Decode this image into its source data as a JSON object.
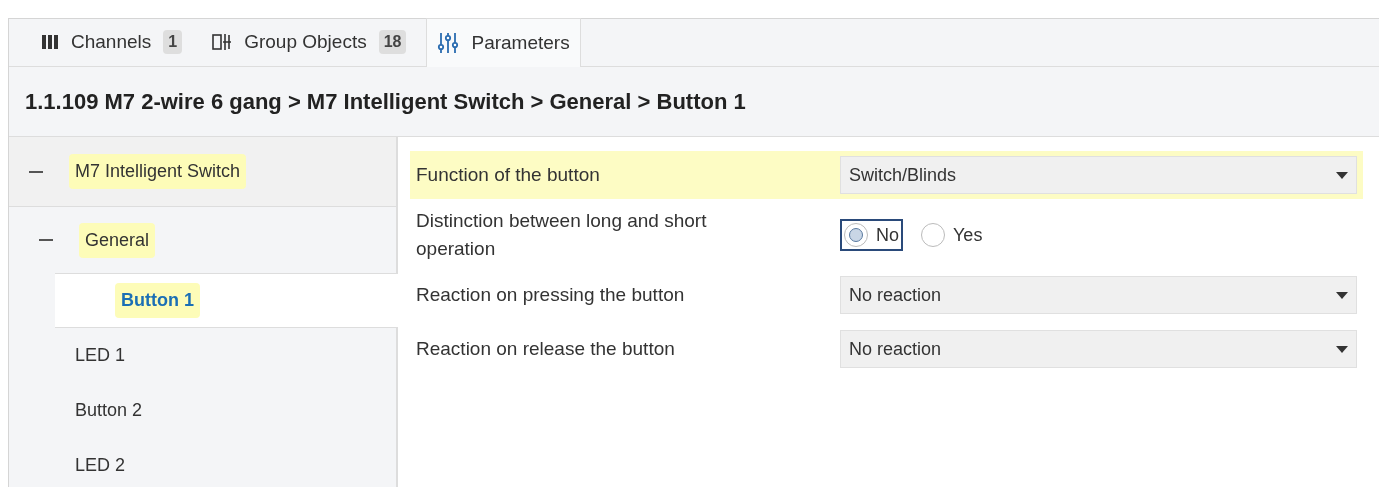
{
  "tabs": [
    {
      "kind": "channels",
      "label": "Channels",
      "count": "1",
      "selected": false
    },
    {
      "kind": "group-objects",
      "label": "Group Objects",
      "count": "18",
      "selected": false
    },
    {
      "kind": "parameters",
      "label": "Parameters",
      "selected": true
    }
  ],
  "breadcrumb": "1.1.109 M7 2-wire 6 gang > M7 Intelligent Switch > General > Button 1",
  "tree": [
    {
      "label": "M7 Intelligent Switch",
      "expanded": true,
      "highlighted": true,
      "selected": false,
      "children": [
        {
          "label": "General",
          "expanded": true,
          "highlighted": true,
          "selected": false,
          "children": [
            {
              "label": "Button 1",
              "highlighted": true,
              "selected": true
            },
            {
              "label": "LED 1",
              "highlighted": false,
              "selected": false
            },
            {
              "label": "Button 2",
              "highlighted": false,
              "selected": false
            },
            {
              "label": "LED 2",
              "highlighted": false,
              "selected": false
            }
          ]
        }
      ]
    }
  ],
  "parameters": [
    {
      "kind": "dropdown",
      "label": "Function of the button",
      "value": "Switch/Blinds",
      "highlighted": true
    },
    {
      "kind": "radio",
      "label": "Distinction between long and short operation",
      "highlighted": false,
      "options": [
        {
          "label": "No",
          "selected": true
        },
        {
          "label": "Yes",
          "selected": false
        }
      ]
    },
    {
      "kind": "dropdown",
      "label": "Reaction on pressing the button",
      "value": "No reaction",
      "highlighted": false
    },
    {
      "kind": "dropdown",
      "label": "Reaction on release the button",
      "value": "No reaction",
      "highlighted": false
    }
  ]
}
